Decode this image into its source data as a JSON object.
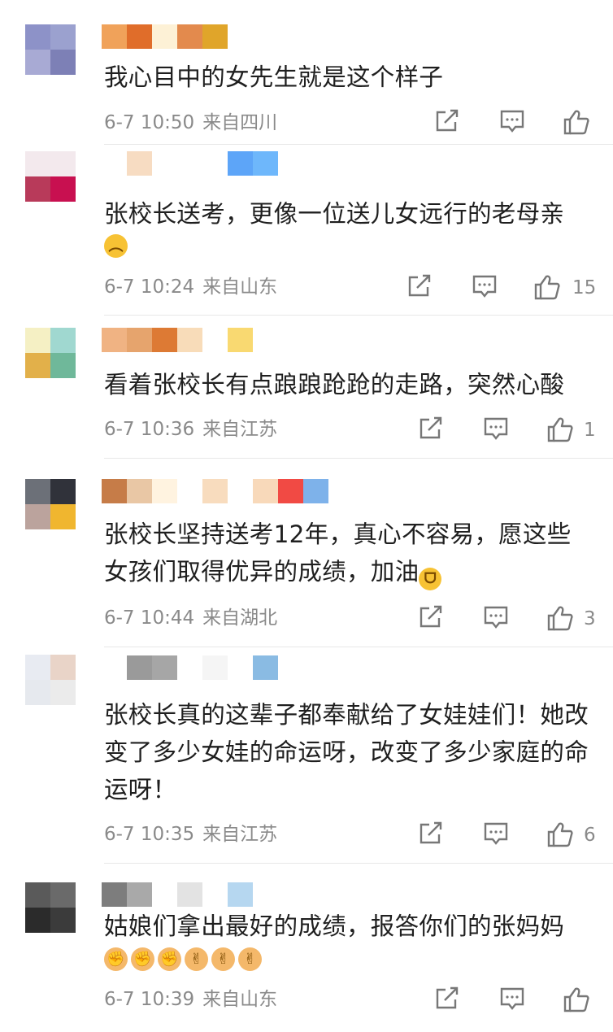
{
  "comments": [
    {
      "text": "我心目中的女先生就是这个样子",
      "time": "6-7 10:50",
      "location": "来自四川",
      "likes": "",
      "avatar_colors": [
        "#8d92c8",
        "#9ba1cf",
        "#a8aad4",
        "#7d80b6"
      ],
      "name_colors": [
        "#f0a25a",
        "#e06d2a",
        "#fdf1d6",
        "#e38a4d",
        "#e0a52a"
      ],
      "emojis": []
    },
    {
      "text": "张校长送考，更像一位送儿女远行的老母亲",
      "time": "6-7 10:24",
      "location": "来自山东",
      "likes": "15",
      "avatar_colors": [
        "#f3e9ed",
        "#f3e9ed",
        "#b83a5a",
        "#c81050"
      ],
      "name_colors": [
        "#ffffff",
        "#f7dcc2",
        "#ffffff",
        "#ffffff",
        "#ffffff",
        "#5da5f8",
        "#6eb7fb"
      ],
      "emojis": [
        "worried-emoji"
      ]
    },
    {
      "text": "看着张校长有点踉踉跄跄的走路，突然心酸",
      "time": "6-7 10:36",
      "location": "来自江苏",
      "likes": "1",
      "avatar_colors": [
        "#f5f0c4",
        "#a0d8d0",
        "#e2b04a",
        "#6fb89a"
      ],
      "name_colors": [
        "#f0b383",
        "#e6a46d",
        "#dd7a34",
        "#f8dcb9",
        "#ffffff",
        "#f9d971"
      ],
      "emojis": []
    },
    {
      "text": "张校长坚持送考12年，真心不容易，愿这些女孩们取得优异的成绩，加油",
      "time": "6-7 10:44",
      "location": "来自湖北",
      "likes": "3",
      "avatar_colors": [
        "#6c7078",
        "#30323a",
        "#bba39d",
        "#f0b62f"
      ],
      "name_colors": [
        "#c67c48",
        "#e9c7a5",
        "#fff3e0",
        "#ffffff",
        "#f8dcbe",
        "#ffffff",
        "#f8d9ba",
        "#f14a44",
        "#7eb2ea"
      ],
      "emojis": [
        "cheer-emoji"
      ]
    },
    {
      "text": "张校长真的这辈子都奉献给了女娃娃们！她改变了多少女娃的命运呀，改变了多少家庭的命运呀！",
      "time": "6-7 10:35",
      "location": "来自江苏",
      "likes": "6",
      "avatar_colors": [
        "#e8ebf2",
        "#e9d4c8",
        "#e6e9ee",
        "#ebebeb"
      ],
      "name_colors": [
        "#ffffff",
        "#9a9a9a",
        "#a6a6a6",
        "#ffffff",
        "#f5f5f5",
        "#ffffff",
        "#8abbe3"
      ],
      "emojis": []
    },
    {
      "text": "姑娘们拿出最好的成绩，报答你们的张妈妈",
      "time": "6-7 10:39",
      "location": "来自山东",
      "likes": "",
      "avatar_colors": [
        "#5a5a5a",
        "#6a6a6a",
        "#2b2b2b",
        "#3b3b3b"
      ],
      "name_colors": [
        "#7d7d7d",
        "#a9a9a9",
        "#ffffff",
        "#e3e3e3",
        "#ffffff",
        "#b6d7f0"
      ],
      "emojis": [
        "fist-emoji",
        "fist-emoji",
        "fist-emoji",
        "victory-emoji",
        "victory-emoji",
        "victory-emoji"
      ]
    }
  ],
  "emoji_glyphs": {
    "worried-emoji": "︵",
    "cheer-emoji": "ᗜ",
    "fist-emoji": "✊",
    "victory-emoji": "✌"
  }
}
